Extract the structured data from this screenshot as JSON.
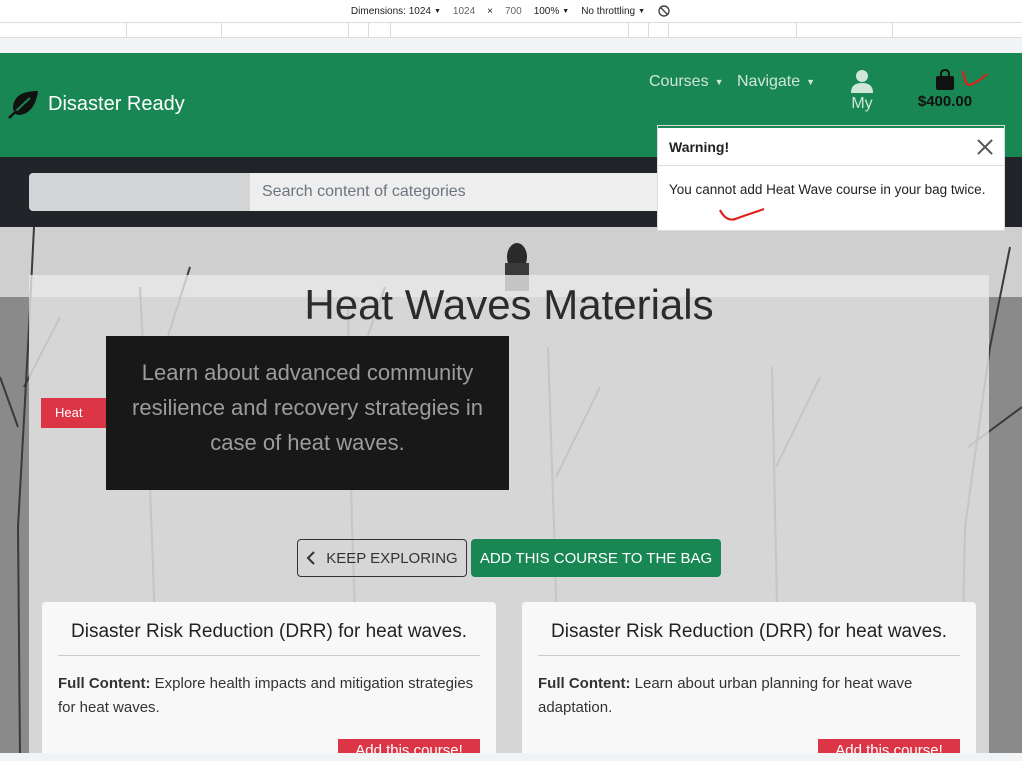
{
  "devtools": {
    "dimensions_label": "Dimensions: 1024",
    "width": "1024",
    "times": "×",
    "height": "700",
    "zoom": "100%",
    "throttling": "No throttling"
  },
  "navbar": {
    "brand": "Disaster Ready",
    "courses": "Courses",
    "navigate": "Navigate",
    "user": "My",
    "bag_total": "$400.00"
  },
  "search": {
    "placeholder": "Search content of categories"
  },
  "hero": {
    "title": "Heat Waves Materials",
    "image_alt": "Heat",
    "description": "Learn about advanced community resilience and recovery strategies in case of heat waves.",
    "explore_btn": "KEEP EXPLORING",
    "add_btn": "ADD THIS COURSE TO THE BAG"
  },
  "cards": [
    {
      "title": "Disaster Risk Reduction (DRR) for heat waves.",
      "content_label": "Full Content:",
      "content": "Explore health impacts and mitigation strategies for heat waves.",
      "add": "Add this course!"
    },
    {
      "title": "Disaster Risk Reduction (DRR) for heat waves.",
      "content_label": "Full Content:",
      "content": "Learn about urban planning for heat wave adaptation.",
      "add": "Add this course!"
    }
  ],
  "toast": {
    "title": "Warning!",
    "message": "You cannot add Heat Wave course in your bag twice."
  },
  "colors": {
    "brand": "#198754",
    "danger": "#dc3545",
    "dark": "#212529",
    "annotation": "#e0201b"
  }
}
